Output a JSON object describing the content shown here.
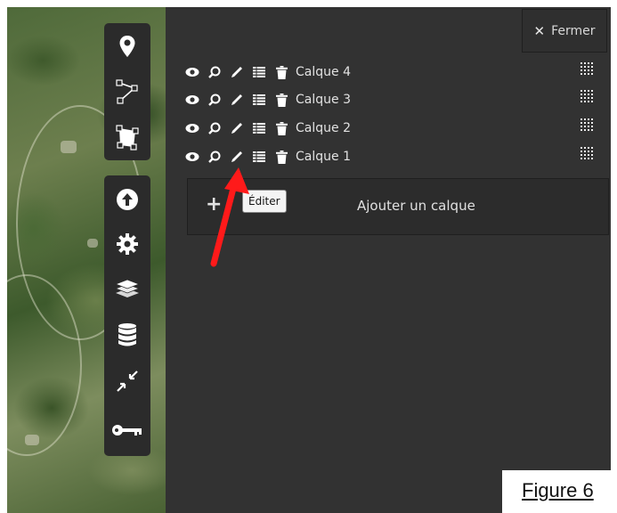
{
  "panel": {
    "close_label": "Fermer",
    "layers": [
      {
        "name": "Calque 4"
      },
      {
        "name": "Calque 3"
      },
      {
        "name": "Calque 2"
      },
      {
        "name": "Calque 1"
      }
    ],
    "add_layer_label": "Ajouter un calque",
    "add_symbol": "+",
    "tooltip": "Éditer"
  },
  "toolbar": {
    "top_icons": [
      "map-marker-icon",
      "polyline-icon",
      "polygon-icon"
    ],
    "bottom_icons": [
      "upload-icon",
      "gear-icon",
      "layers-icon",
      "database-icon",
      "compress-icon",
      "key-icon"
    ]
  },
  "caption": "Figure 6",
  "colors": {
    "panel_bg": "#323232",
    "toolbar_bg": "#2b2b2b",
    "annotation_arrow": "#ff1a1a",
    "text": "#e2e2e2"
  }
}
